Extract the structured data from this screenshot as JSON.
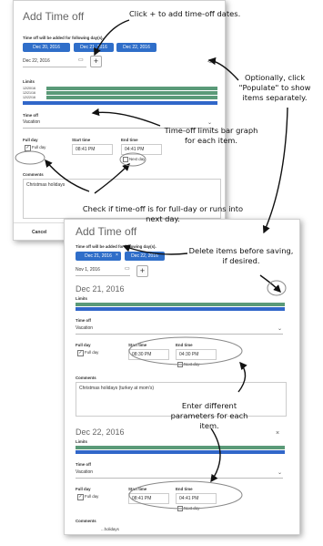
{
  "panel1": {
    "title": "Add Time off",
    "days_label": "Time off will be added for following day(s).",
    "chips": [
      "Dec 20, 2016",
      "Dec 21, 2016",
      "Dec 22, 2016"
    ],
    "date_value": "Dec 22, 2016",
    "limits_label": "Limits",
    "limit_rows": [
      "12/20/16",
      "12/21/16",
      "12/22/16"
    ],
    "time_off_label": "Time off",
    "time_off_value": "Vacation",
    "full_day_label": "Full day",
    "full_day_checkbox": "Full day",
    "start_label": "Start time",
    "start_value": "08:41 PM",
    "end_label": "End time",
    "end_value": "04:41 PM",
    "next_day": "Next day",
    "comments_label": "Comments",
    "comments_value": "Christmas holidays",
    "cancel": "Cancel"
  },
  "panel2": {
    "title": "Add Time off",
    "days_label": "Time off will be added for following day(s).",
    "chips": [
      "Dec 21, 2016",
      "Dec 22, 2016"
    ],
    "date_value": "Nov 1, 2016",
    "item1": {
      "heading": "Dec 21, 2016",
      "limits_label": "Limits",
      "time_off_label": "Time off",
      "time_off_value": "Vacation",
      "full_day_label": "Full day",
      "full_day_checkbox": "Full day",
      "start_label": "Start time",
      "start_value": "08:30 PM",
      "end_label": "End time",
      "end_value": "04:30 PM",
      "next_day": "Next day",
      "comments_label": "Comments",
      "comments_value": "Christmas holidays (turkey at mom's)"
    },
    "item2": {
      "heading": "Dec 22, 2016",
      "limits_label": "Limits",
      "time_off_label": "Time off",
      "time_off_value": "Vacation",
      "full_day_label": "Full day",
      "full_day_checkbox": "Full day",
      "start_label": "Start time",
      "start_value": "08:41 PM",
      "end_label": "End time",
      "end_value": "04:41 PM",
      "next_day": "Next day",
      "comments_label": "Comments",
      "comments_value": "...holidays"
    }
  },
  "annotations": {
    "click_plus": "Click + to add time-off dates.",
    "populate": "Optionally, click \"Populate\" to show items separately.",
    "limits": "Time-off limits bar graph for each item.",
    "full_day": "Check if time-off is for full-day or runs into next day.",
    "delete": "Delete items before saving, if desired.",
    "params": "Enter different parameters for each item."
  },
  "icons": {
    "calendar": "calendar-icon",
    "share": "share-icon",
    "close": "close-icon",
    "chevron": "chevron-down-icon"
  }
}
